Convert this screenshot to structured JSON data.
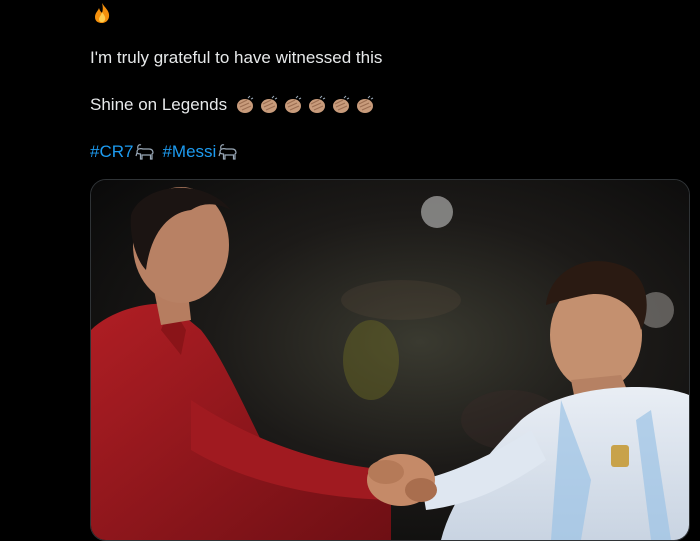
{
  "tweet": {
    "line_1": "I'm truly grateful to have witnessed this",
    "line_2": "Shine on Legends",
    "hashtags": [
      "#CR7",
      "#Messi"
    ],
    "emoji": {
      "top": "fire-emoji",
      "line_2_repeat": "clapping-hands-emoji",
      "hashtag_suffix": "goat-emoji"
    },
    "clap_count": 6
  },
  "media": {
    "type": "photo",
    "description_icon": "photo-two-footballers-handshake"
  },
  "colors": {
    "background": "#000000",
    "text": "#e7e9ea",
    "link": "#1d9bf0"
  }
}
